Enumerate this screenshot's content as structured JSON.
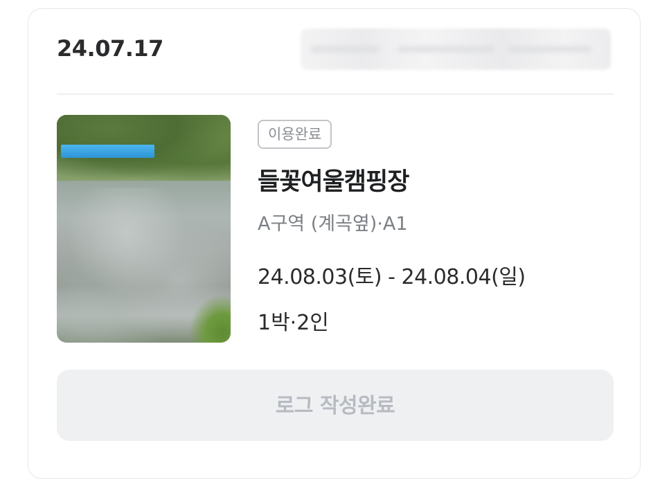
{
  "order": {
    "date": "24.07.17"
  },
  "reservation": {
    "status_badge": "이용완료",
    "site_name": "들꽃여울캠핑장",
    "zone": "A구역 (계곡옆)·A1",
    "dates": "24.08.03(토) - 24.08.04(일)",
    "guests": "1박·2인"
  },
  "actions": {
    "log_button_label": "로그 작성완료"
  },
  "colors": {
    "card_border": "#e6e7e9",
    "badge_border": "#c2c4c8",
    "button_bg": "#eef0f2",
    "button_text": "#b7bbc1"
  }
}
